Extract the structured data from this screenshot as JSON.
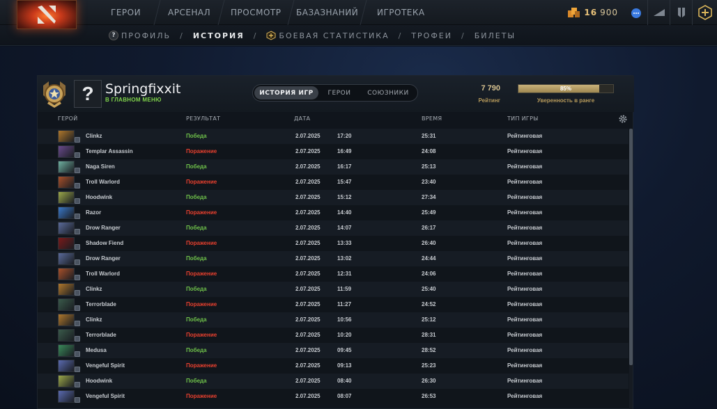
{
  "nav": {
    "tabs": [
      "ГЕРОИ",
      "АРСЕНАЛ",
      "ПРОСМОТР",
      "БАЗАЗНАНИЙ",
      "ИГРОТЕКА"
    ]
  },
  "currency": {
    "shards_a": "16",
    "shards_b": "900"
  },
  "subnav": {
    "profile": "ПРОФИЛЬ",
    "history": "ИСТОРИЯ",
    "stats": "БОЕВАЯ СТАТИСТИКА",
    "trophies": "ТРОФЕИ",
    "tickets": "БИЛЕТЫ",
    "separator": "/"
  },
  "profile": {
    "avatar_glyph": "?",
    "name": "Springfixxit",
    "status": "В ГЛАВНОМ МЕНЮ",
    "rating_value": "7 790",
    "rating_label": "Рейтинг",
    "confidence_text": "85%",
    "confidence_fraction": 0.85,
    "confidence_label": "Уверенность в ранге"
  },
  "segments": [
    "ИСТОРИЯ ИГР",
    "ГЕРОИ",
    "СОЮЗНИКИ"
  ],
  "columns": {
    "hero": "ГЕРОЙ",
    "result": "РЕЗУЛЬТАТ",
    "date": "ДАТА",
    "duration": "ВРЕМЯ",
    "type": "ТИП ИГРЫ"
  },
  "colors": {
    "win": "#6fc24a",
    "loss": "#e8402e",
    "accent_gold": "#d8c391"
  },
  "matches": [
    {
      "hero": "Clinkz",
      "result": "Победа",
      "win": true,
      "date": "2.07.2025",
      "time": "17:20",
      "duration": "25:31",
      "type": "Рейтинговая",
      "portrait": "#b0782c"
    },
    {
      "hero": "Templar Assassin",
      "result": "Поражение",
      "win": false,
      "date": "2.07.2025",
      "time": "16:49",
      "duration": "24:08",
      "type": "Рейтинговая",
      "portrait": "#6a4a8c"
    },
    {
      "hero": "Naga Siren",
      "result": "Победа",
      "win": true,
      "date": "2.07.2025",
      "time": "16:17",
      "duration": "25:13",
      "type": "Рейтинговая",
      "portrait": "#6fb0a0"
    },
    {
      "hero": "Troll Warlord",
      "result": "Поражение",
      "win": false,
      "date": "2.07.2025",
      "time": "15:47",
      "duration": "23:40",
      "type": "Рейтинговая",
      "portrait": "#a8502a"
    },
    {
      "hero": "Hoodwink",
      "result": "Победа",
      "win": true,
      "date": "2.07.2025",
      "time": "15:12",
      "duration": "27:34",
      "type": "Рейтинговая",
      "portrait": "#9ca84a"
    },
    {
      "hero": "Razor",
      "result": "Поражение",
      "win": false,
      "date": "2.07.2025",
      "time": "14:40",
      "duration": "25:49",
      "type": "Рейтинговая",
      "portrait": "#3a78c8"
    },
    {
      "hero": "Drow Ranger",
      "result": "Победа",
      "win": true,
      "date": "2.07.2025",
      "time": "14:07",
      "duration": "26:17",
      "type": "Рейтинговая",
      "portrait": "#5a6a9a"
    },
    {
      "hero": "Shadow Fiend",
      "result": "Поражение",
      "win": false,
      "date": "2.07.2025",
      "time": "13:33",
      "duration": "26:40",
      "type": "Рейтинговая",
      "portrait": "#7a1a1a"
    },
    {
      "hero": "Drow Ranger",
      "result": "Победа",
      "win": true,
      "date": "2.07.2025",
      "time": "13:02",
      "duration": "24:44",
      "type": "Рейтинговая",
      "portrait": "#5a6a9a"
    },
    {
      "hero": "Troll Warlord",
      "result": "Поражение",
      "win": false,
      "date": "2.07.2025",
      "time": "12:31",
      "duration": "24:06",
      "type": "Рейтинговая",
      "portrait": "#a8502a"
    },
    {
      "hero": "Clinkz",
      "result": "Победа",
      "win": true,
      "date": "2.07.2025",
      "time": "11:59",
      "duration": "25:40",
      "type": "Рейтинговая",
      "portrait": "#b0782c"
    },
    {
      "hero": "Terrorblade",
      "result": "Поражение",
      "win": false,
      "date": "2.07.2025",
      "time": "11:27",
      "duration": "24:52",
      "type": "Рейтинговая",
      "portrait": "#3a5a4a"
    },
    {
      "hero": "Clinkz",
      "result": "Победа",
      "win": true,
      "date": "2.07.2025",
      "time": "10:56",
      "duration": "25:12",
      "type": "Рейтинговая",
      "portrait": "#b0782c"
    },
    {
      "hero": "Terrorblade",
      "result": "Поражение",
      "win": false,
      "date": "2.07.2025",
      "time": "10:20",
      "duration": "28:31",
      "type": "Рейтинговая",
      "portrait": "#3a5a4a"
    },
    {
      "hero": "Medusa",
      "result": "Победа",
      "win": true,
      "date": "2.07.2025",
      "time": "09:45",
      "duration": "28:52",
      "type": "Рейтинговая",
      "portrait": "#3a8a5a"
    },
    {
      "hero": "Vengeful Spirit",
      "result": "Поражение",
      "win": false,
      "date": "2.07.2025",
      "time": "09:13",
      "duration": "25:23",
      "type": "Рейтинговая",
      "portrait": "#5a6ab0"
    },
    {
      "hero": "Hoodwink",
      "result": "Победа",
      "win": true,
      "date": "2.07.2025",
      "time": "08:40",
      "duration": "26:30",
      "type": "Рейтинговая",
      "portrait": "#9ca84a"
    },
    {
      "hero": "Vengeful Spirit",
      "result": "Поражение",
      "win": false,
      "date": "2.07.2025",
      "time": "08:07",
      "duration": "26:53",
      "type": "Рейтинговая",
      "portrait": "#5a6ab0"
    }
  ]
}
